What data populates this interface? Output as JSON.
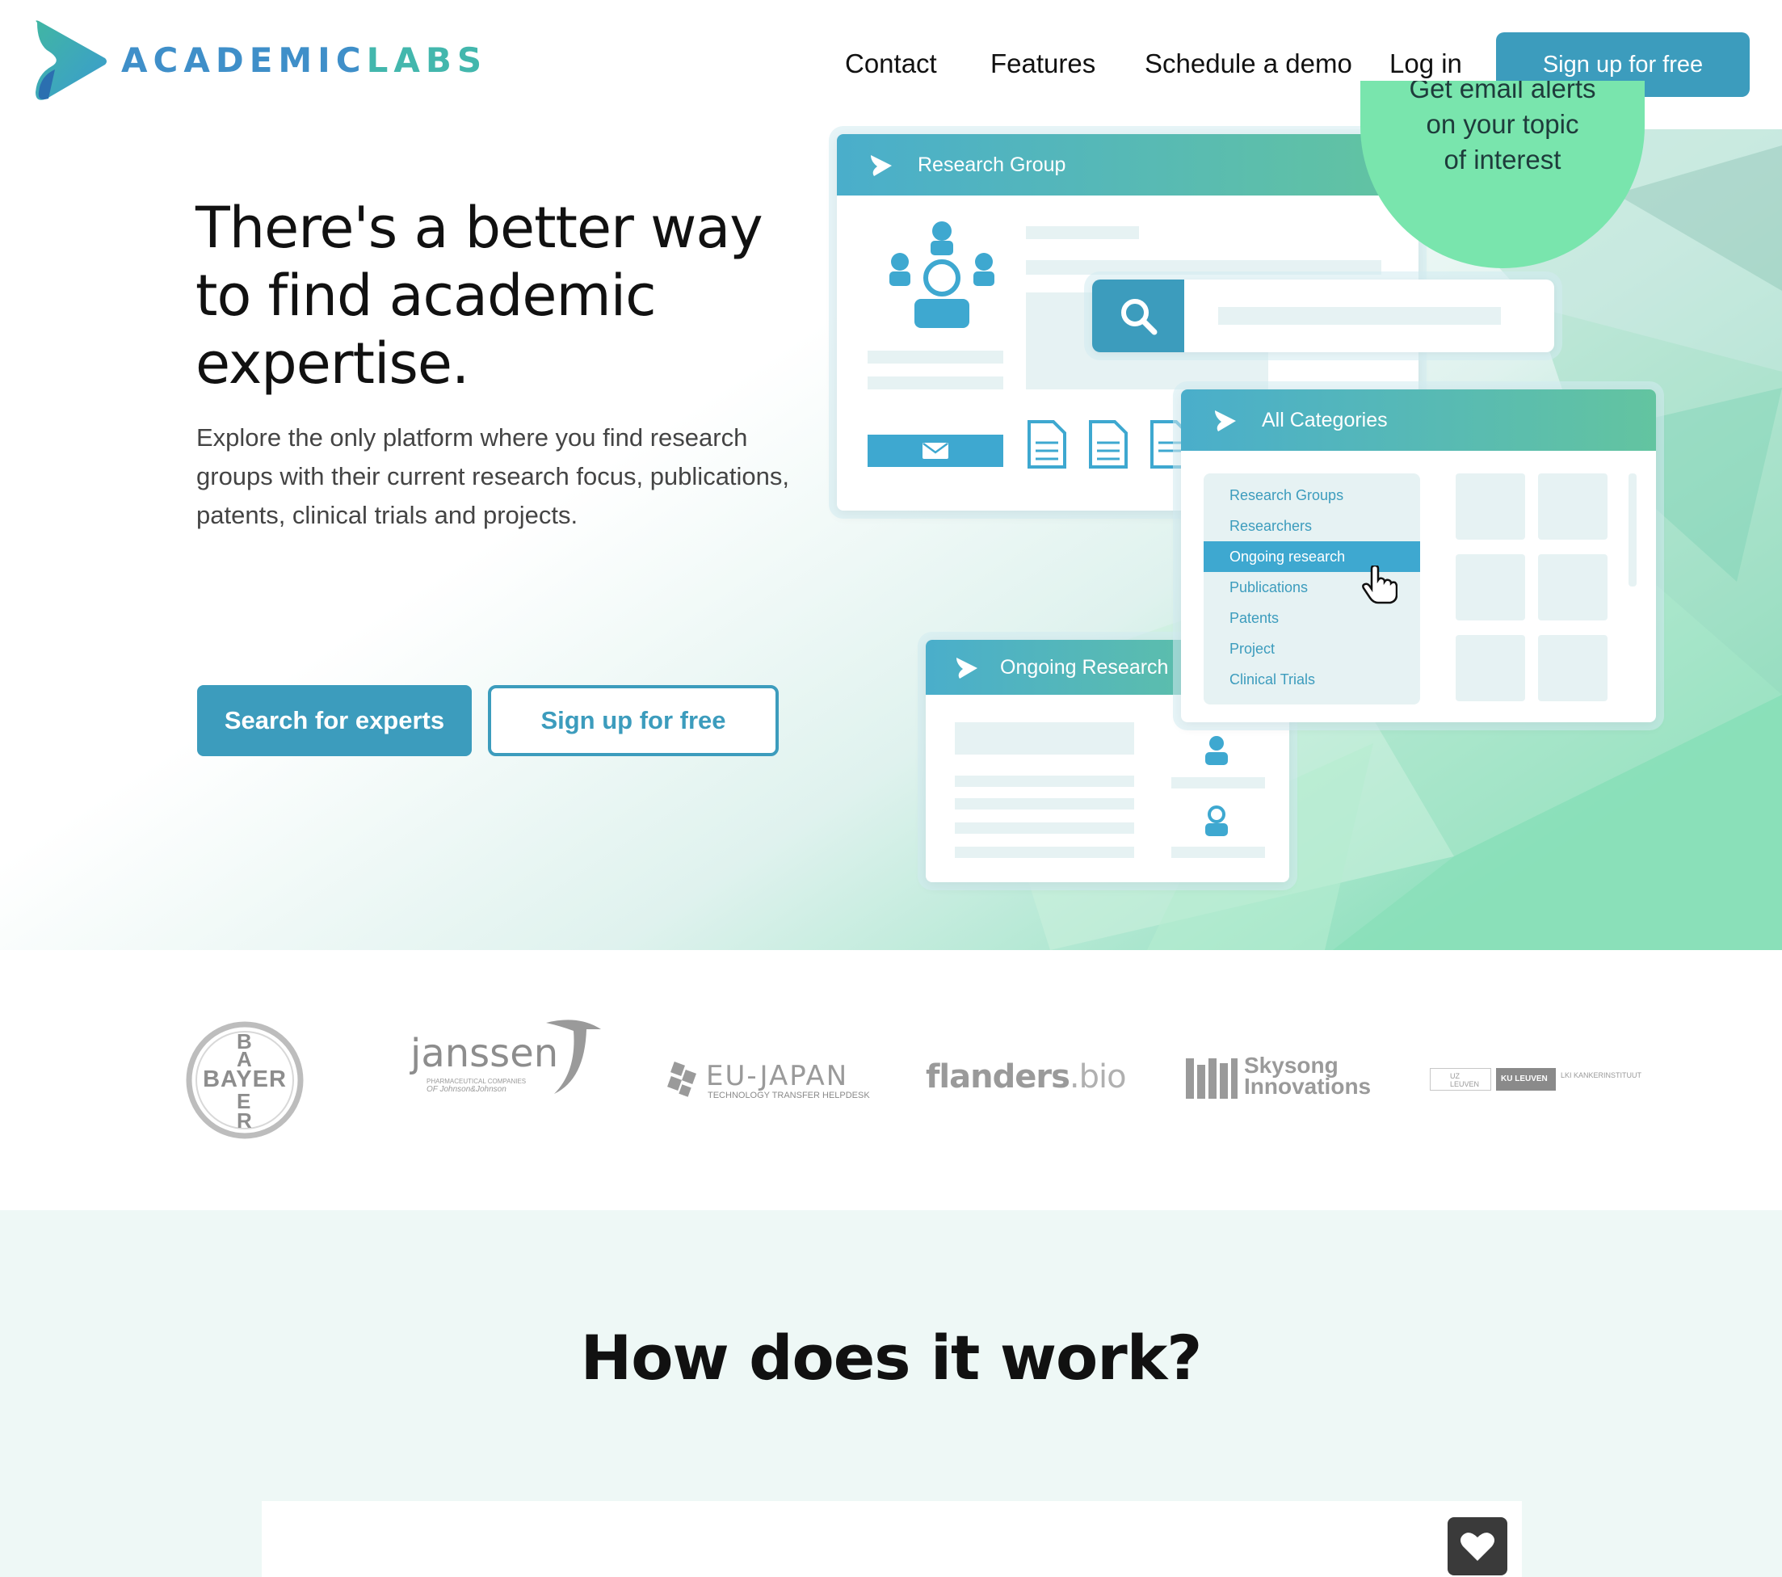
{
  "brand": {
    "name_part1": "ACADEMIC",
    "name_part2": "LABS"
  },
  "nav": {
    "contact": "Contact",
    "features": "Features",
    "schedule_demo": "Schedule a demo",
    "login": "Log in",
    "signup": "Sign up for free"
  },
  "hero": {
    "title": "There's a better way to find academic expertise.",
    "description": "Explore the only platform where you find research groups with their current research focus, publications, patents, clinical trials and projects.",
    "search_button": "Search for experts",
    "signup_button": "Sign up for free"
  },
  "illustration": {
    "research_group_title": "Research Group",
    "alert_text_top": "Get email alerts",
    "alert_text_line2": "on your topic",
    "alert_text_line3": "of interest",
    "all_categories_title": "All Categories",
    "categories": [
      "Research Groups",
      "Researchers",
      "Ongoing research",
      "Publications",
      "Patents",
      "Project",
      "Clinical Trials"
    ],
    "active_category": "Ongoing research",
    "ongoing_research_title": "Ongoing Research"
  },
  "partners": {
    "bayer": "BAYER",
    "bayer_letters_top": "B",
    "bayer_letters": [
      "A",
      "E",
      "R"
    ],
    "janssen": "janssen",
    "janssen_sub": "PHARMACEUTICAL COMPANIES",
    "janssen_sub2": "OF Johnson&Johnson",
    "eujapan": "EU-JAPAN",
    "eujapan_sub": "TECHNOLOGY TRANSFER HELPDESK",
    "flanders_main": "flanders",
    "flanders_suffix": ".bio",
    "skysong_1": "Skysong",
    "skysong_2": "Innovations",
    "uz": "UZ LEUVEN",
    "ku": "KU LEUVEN",
    "lki": "LKI KANKERINSTITUUT"
  },
  "how": {
    "title": "How does it work?"
  },
  "colors": {
    "primary": "#3c9cbd",
    "accent_green": "#79e5ad",
    "logo_blue": "#3f8fc9",
    "logo_teal": "#43b7ad"
  },
  "icons": [
    "logo-play-icon",
    "search-icon",
    "mail-icon",
    "document-icon",
    "person-icon",
    "group-icon",
    "pointer-hand-icon",
    "heart-icon"
  ]
}
